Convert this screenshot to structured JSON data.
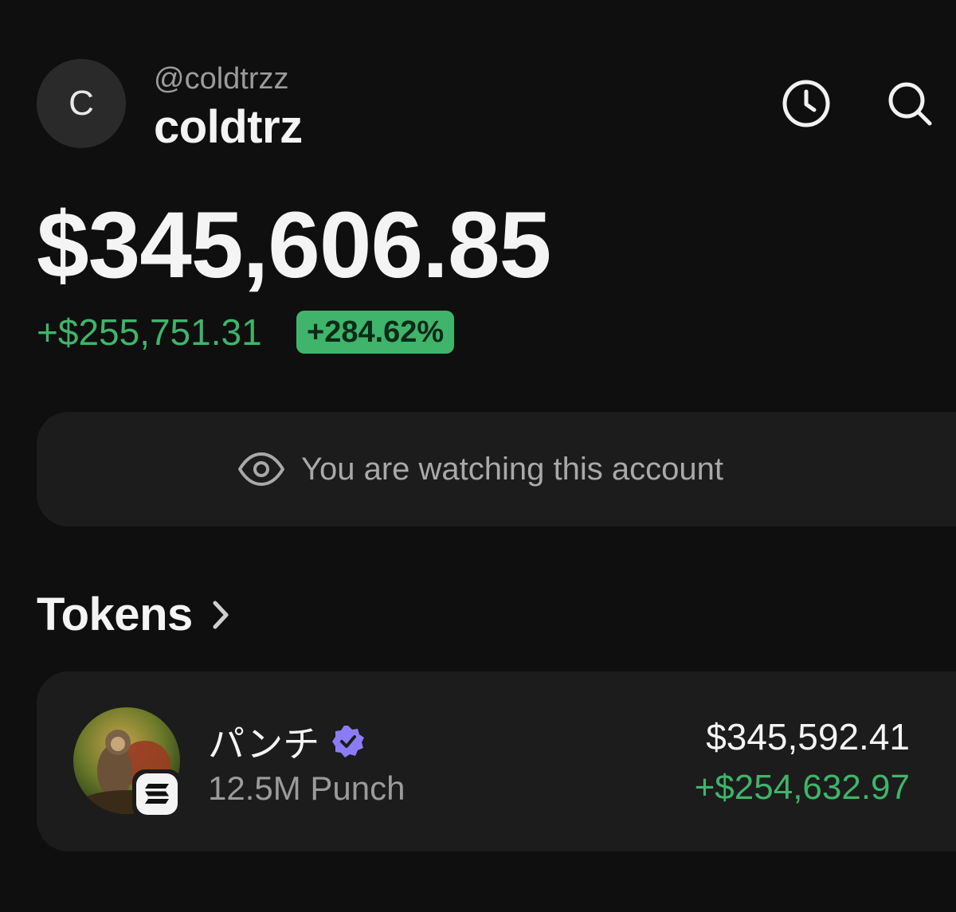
{
  "profile": {
    "avatar_letter": "C",
    "handle": "@coldtrzz",
    "username": "coldtrz"
  },
  "header": {
    "history_icon": "clock-icon",
    "search_icon": "search-icon"
  },
  "portfolio": {
    "balance": "$345,606.85",
    "change_amount": "+$255,751.31",
    "change_percent": "+284.62%"
  },
  "watch_banner": {
    "icon": "eye-icon",
    "text": "You are watching this account"
  },
  "tokens": {
    "heading": "Tokens",
    "items": [
      {
        "name": "パンチ",
        "verified_icon": "verified-badge-icon",
        "chain_icon": "solana-icon",
        "amount": "12.5M Punch",
        "value": "$345,592.41",
        "pnl": "+$254,632.97"
      }
    ]
  },
  "colors": {
    "background": "#0f0f0f",
    "card": "#1c1c1c",
    "positive": "#3fb46a",
    "verified": "#8b7cf6"
  }
}
